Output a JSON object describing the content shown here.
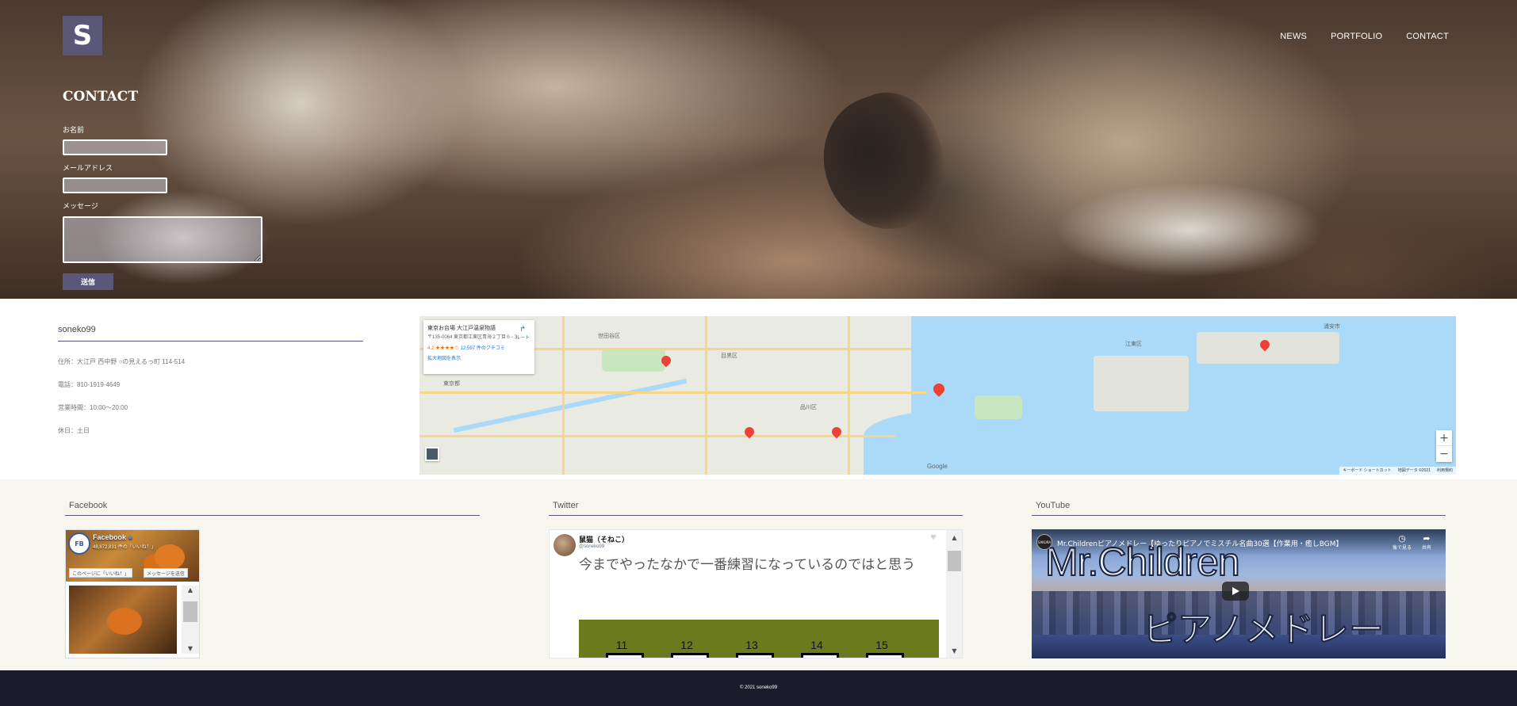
{
  "header": {
    "logo_letter": "S",
    "nav": [
      "NEWS",
      "PORTFOLIO",
      "CONTACT"
    ]
  },
  "contact_form": {
    "title": "CONTACT",
    "name_label": "お名前",
    "email_label": "メールアドレス",
    "message_label": "メッセージ",
    "name_value": "",
    "email_value": "",
    "message_value": "",
    "submit_label": "送信"
  },
  "info": {
    "name": "soneko99",
    "address": "住所：大江戸 西中野 ○の見えるっ町 114-514",
    "phone": "電話：810-1919-4649",
    "hours": "営業時間：10:00〜20:00",
    "holiday": "休日：土日"
  },
  "map": {
    "card_title": "東京お台場 大江戸温泉物語",
    "card_address": "〒135-0064 東京都江東区青海２丁目６−３",
    "card_rating": "4.2 ★★★★☆",
    "card_reviews": "12,597 件のクチコミ",
    "card_bigger_map": "拡大地図を表示",
    "card_route": "ルート",
    "google_label": "Google",
    "attribution": [
      "キーボード ショートカット",
      "地図データ ©2021",
      "利用規約"
    ],
    "places": [
      "世田谷区",
      "目黒区",
      "品川区",
      "東京都",
      "浦安市",
      "江東区"
    ],
    "zoom_in": "+",
    "zoom_out": "−"
  },
  "social": {
    "facebook_title": "Facebook",
    "twitter_title": "Twitter",
    "youtube_title": "YouTube",
    "facebook": {
      "avatar": "FB",
      "page_name": "Facebook",
      "likes": "48,872,831 件の「いいね！」",
      "like_button": "このページに「いいね！」",
      "message_button": "メッセージを送信"
    },
    "twitter": {
      "name": "鼠猫（そねこ）",
      "handle": "@soneko99",
      "text": "今までやったなかで一番練習になっているのではと思う",
      "numbers": [
        "11",
        "12",
        "13",
        "14",
        "15"
      ]
    },
    "youtube": {
      "channel": "SAKURA",
      "video_title": "Mr.Childrenピアノメドレー【ゆったりピアノでミスチル名曲30選【作業用・癒しBGM】",
      "watch_later": "後で見る",
      "share": "共有",
      "big_title_1": "Mr.Children",
      "big_title_2": "ピアノメドレー"
    }
  },
  "footer": {
    "copyright": "© 2021 soneko99"
  },
  "colors": {
    "accent": "#5a5778",
    "footer_bg": "#1b1c2b",
    "social_bg": "#f8f5ee"
  }
}
